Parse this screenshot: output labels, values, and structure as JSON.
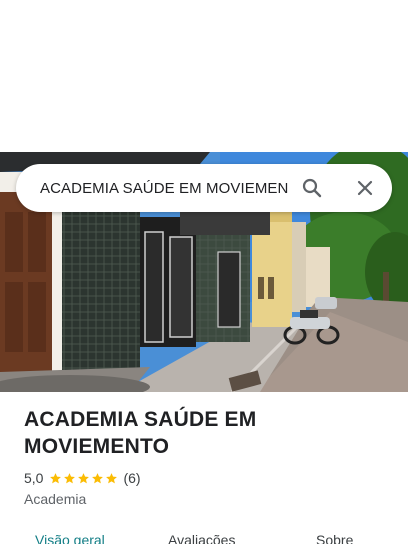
{
  "search": {
    "query": "ACADEMIA SAÚDE EM MOVIEMENTO",
    "search_icon": "search-icon",
    "close_icon": "close-icon"
  },
  "place": {
    "name": "ACADEMIA SAÚDE EM MOVIEMENTO",
    "rating": "5,0",
    "stars": 5,
    "review_count": "(6)",
    "category": "Academia"
  },
  "tabs": [
    {
      "label": "Visão geral",
      "active": true
    },
    {
      "label": "Avaliações",
      "active": false
    },
    {
      "label": "Sobre",
      "active": false
    }
  ],
  "colors": {
    "accent": "#137e86",
    "star": "#fbbc04",
    "title": "#202124"
  }
}
